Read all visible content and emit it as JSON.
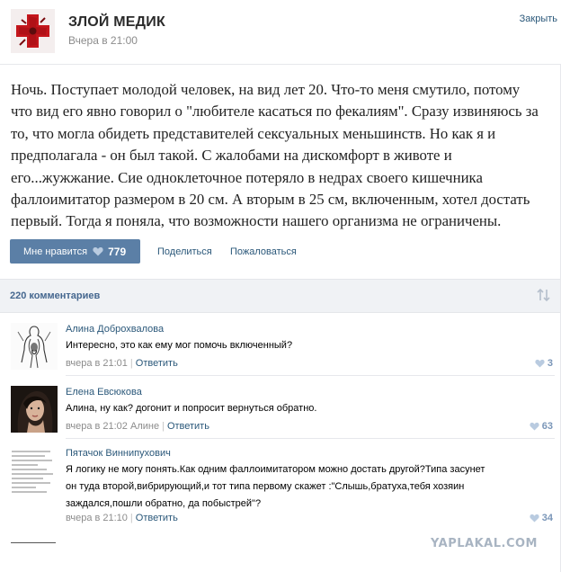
{
  "post": {
    "group_name": "ЗЛОЙ МЕДИК",
    "time": "Вчера в 21:00",
    "close_label": "Закрыть",
    "text_lines": [
      "Ночь. Поступает молодой человек, на вид лет 20. Что-то меня смутило, потому",
      "что вид его явно говорил о \"любителе касаться по фекалиям\". Сразу извиняюсь за",
      "то, что могла обидеть представителей сексуальных меньшинств. Но как я и",
      "предполагала - он был такой. С жалобами на дискомфорт в животе и",
      "его...жужжание. Сие одноклеточное потеряло в недрах своего кишечника",
      "фаллоимитатор размером в 20 см. А вторым в 25 см, включенным, хотел достать",
      "первый. Тогда я поняла, что возможности нашего организма не ограничены."
    ],
    "like_label": "Мне нравится",
    "like_count": "779",
    "share_label": "Поделиться",
    "report_label": "Пожаловаться"
  },
  "comments_header": {
    "count_label": "220 комментариев"
  },
  "comments": [
    {
      "author": "Алина Доброхвалова",
      "lines": [
        "Интересно, это как ему мог помочь включенный?"
      ],
      "time": "вчера в 21:01",
      "addressee": "",
      "reply_label": "Ответить",
      "likes": "3"
    },
    {
      "author": "Елена Евсюкова",
      "lines": [
        "Алина, ну как? догонит и попросит вернуться обратно."
      ],
      "time": "вчера в 21:02",
      "addressee": "Алине",
      "reply_label": "Ответить",
      "likes": "63"
    },
    {
      "author": "Пятачок Виннипухович",
      "lines": [
        "Я логику не могу понять.Как одним фаллоимитатором можно достать другой?Типа засунет",
        "он туда второй,вибрирующий,и тот типа первому скажет :\"Слышь,братуха,тебя хозяин",
        "заждался,пошли обратно, да побыстрей\"?"
      ],
      "time": "вчера в 21:10",
      "addressee": "",
      "reply_label": "Ответить",
      "likes": "34"
    }
  ],
  "watermark": "YAPLAKAL.COM",
  "colors": {
    "link": "#2b587a",
    "like_button": "#5b7fa6",
    "muted": "#8c8c8c"
  }
}
